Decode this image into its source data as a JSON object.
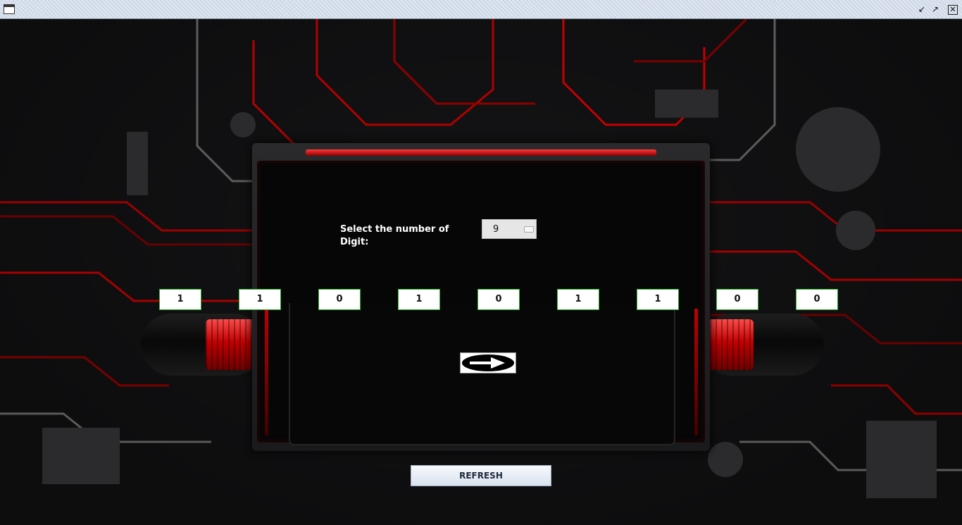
{
  "window": {
    "title": "",
    "controls": [
      "minimize-icon",
      "maximize-icon",
      "close-icon"
    ]
  },
  "form": {
    "digit_label": "Select the number of Digit:",
    "digit_count": "9"
  },
  "digits": [
    "1",
    "1",
    "0",
    "1",
    "0",
    "1",
    "1",
    "0",
    "0"
  ],
  "buttons": {
    "next_icon": "right-arrow-icon",
    "refresh_label": "REFRESH"
  },
  "colors": {
    "accent_red": "#d00000",
    "digit_border": "#2fb52f"
  }
}
